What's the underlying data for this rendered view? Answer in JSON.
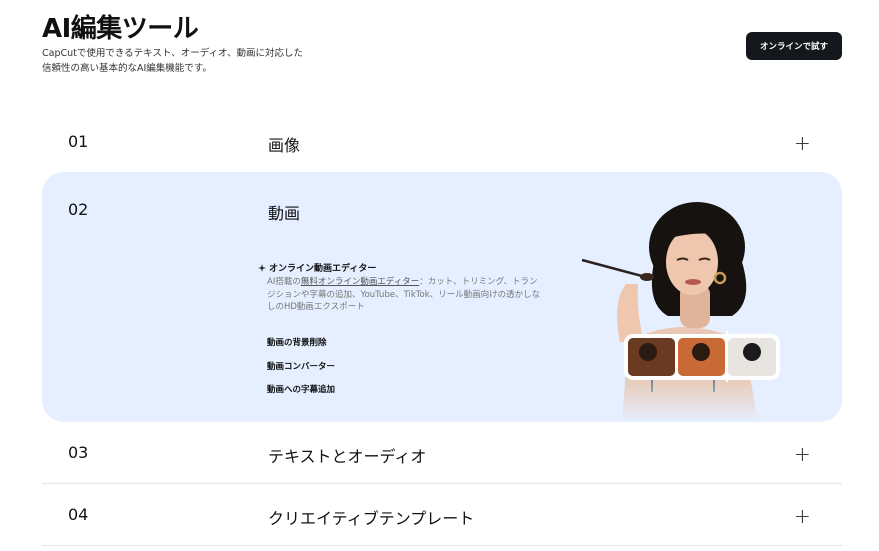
{
  "header": {
    "title": "AI編集ツール",
    "subtitle": "CapCutで使用できるテキスト、オーディオ、動画に対応した信頼性の高い基本的なAI編集機能です。",
    "cta_label": "オンラインで試す"
  },
  "rows": [
    {
      "num": "01",
      "label": "画像",
      "expanded": false,
      "toggle": "+"
    },
    {
      "num": "02",
      "label": "動画",
      "expanded": true
    },
    {
      "num": "03",
      "label": "テキストとオーディオ",
      "expanded": false,
      "toggle": "+"
    },
    {
      "num": "04",
      "label": "クリエイティブテンプレート",
      "expanded": false,
      "toggle": "+"
    }
  ],
  "expanded_panel": {
    "feature_icon": "sparkle-icon",
    "feature_title": "オンライン動画エディター",
    "feature_desc_prefix": "AI搭載の",
    "feature_desc_link": "無料オンライン動画エディター",
    "feature_desc_suffix": "：カット、トリミング、トランジションや字幕の追加、YouTube、TikTok、リール動画向けの透かしなしのHD動画エクスポート",
    "items": [
      "動画の背景削除",
      "動画コンバーター",
      "動画への字幕追加"
    ]
  },
  "colors": {
    "panel_bg": "#e5efff",
    "cta_bg": "#14171c",
    "cta_text": "#ffffff",
    "divider": "#e6e6e6"
  }
}
